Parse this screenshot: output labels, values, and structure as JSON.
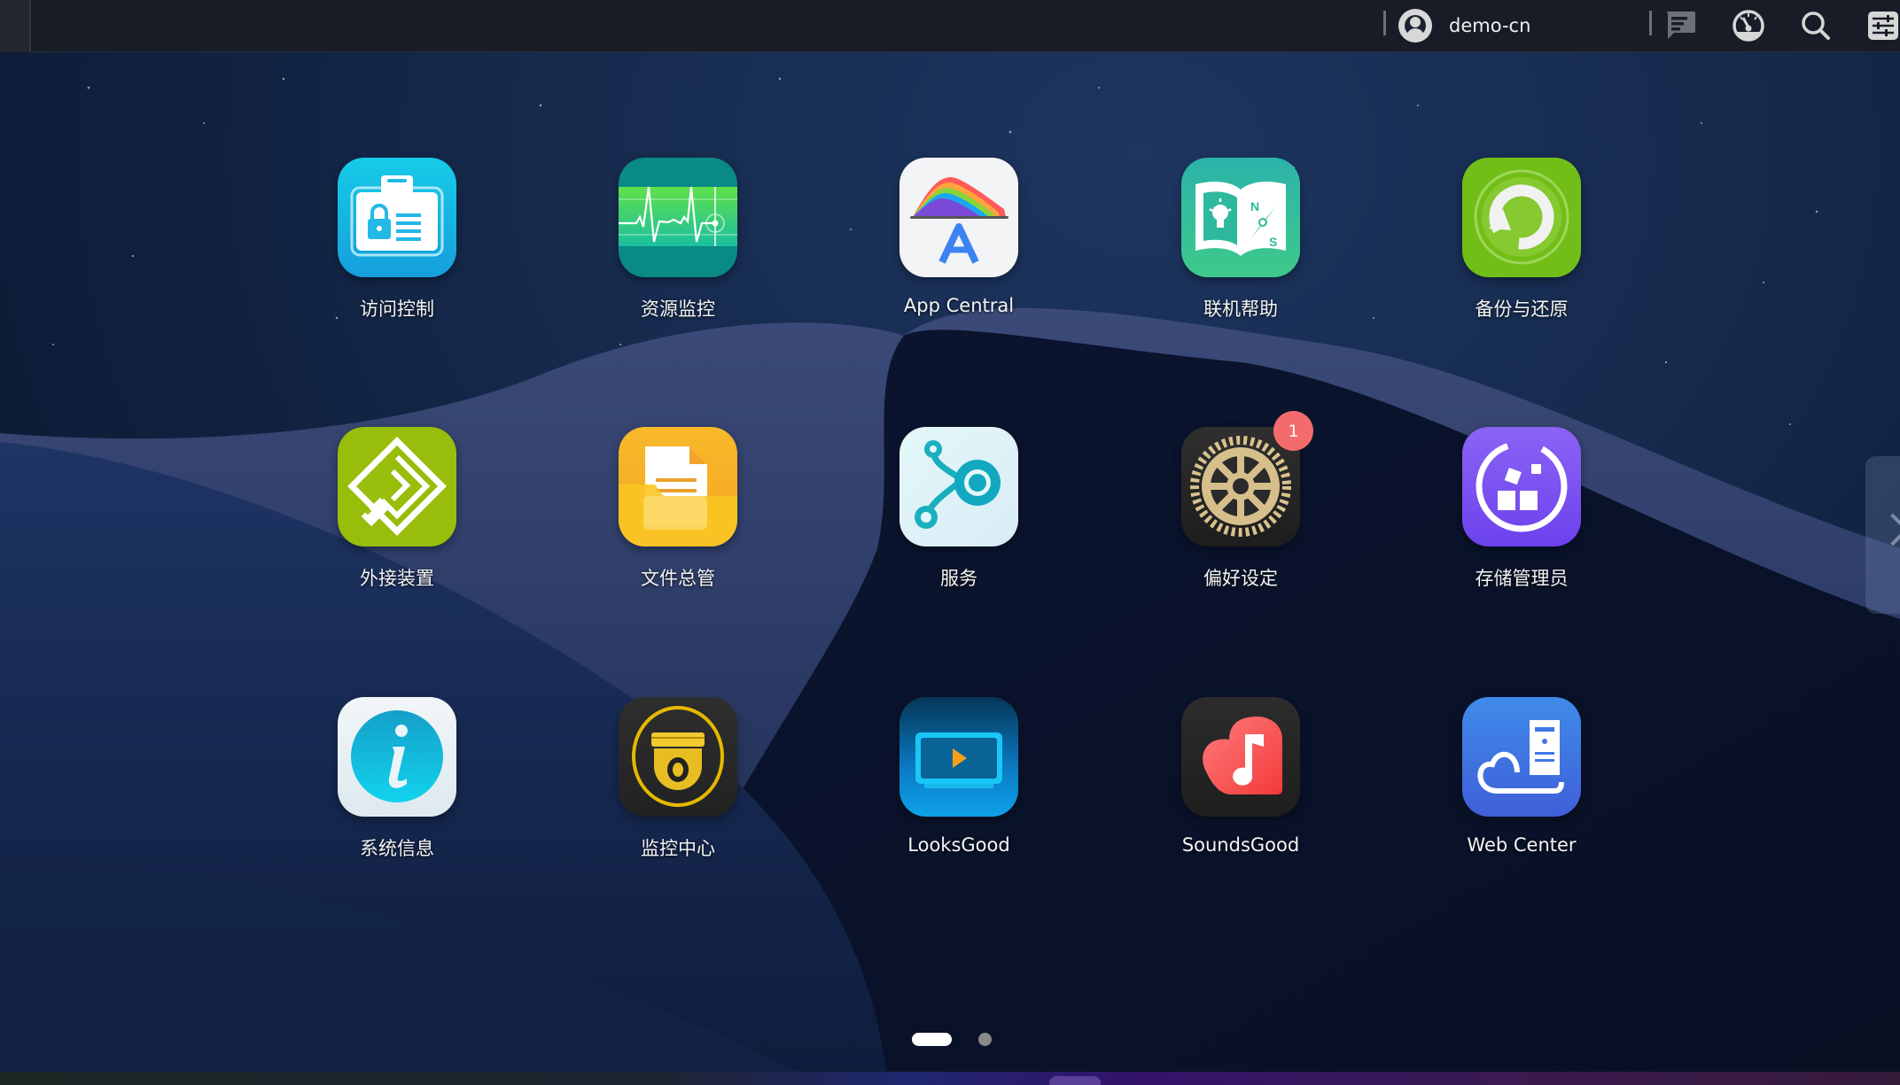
{
  "topbar": {
    "username": "demo-cn",
    "icons": {
      "avatar": "user-circle-icon",
      "messages": "message-icon",
      "dashboard": "dashboard-gauge-icon",
      "search": "search-icon",
      "settings": "sliders-settings-icon"
    }
  },
  "apps": [
    {
      "label": "访问控制",
      "icon": "access-control-icon"
    },
    {
      "label": "资源监控",
      "icon": "resource-monitor-icon"
    },
    {
      "label": "App Central",
      "icon": "app-central-icon"
    },
    {
      "label": "联机帮助",
      "icon": "online-help-icon"
    },
    {
      "label": "备份与还原",
      "icon": "backup-restore-icon"
    },
    {
      "label": "外接装置",
      "icon": "external-devices-icon"
    },
    {
      "label": "文件总管",
      "icon": "file-explorer-icon"
    },
    {
      "label": "服务",
      "icon": "services-icon"
    },
    {
      "label": "偏好设定",
      "icon": "preferences-gear-icon",
      "badge": "1"
    },
    {
      "label": "存储管理员",
      "icon": "storage-manager-icon"
    },
    {
      "label": "系统信息",
      "icon": "system-info-icon"
    },
    {
      "label": "监控中心",
      "icon": "surveillance-center-icon"
    },
    {
      "label": "LooksGood",
      "icon": "looksgood-video-icon"
    },
    {
      "label": "SoundsGood",
      "icon": "soundsgood-music-icon"
    },
    {
      "label": "Web Center",
      "icon": "web-center-icon"
    }
  ],
  "pager": {
    "pages": 2,
    "current": 1
  },
  "colors": {
    "badge": "#f46b6b",
    "topbar": "#171c27",
    "pager_active": "#ffffff",
    "pager_inactive": "#8a8a8a"
  }
}
